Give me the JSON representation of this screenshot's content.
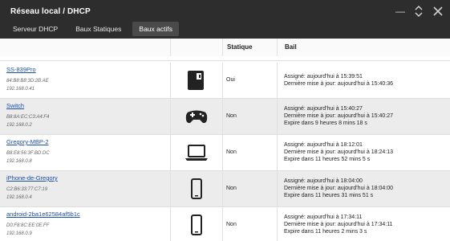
{
  "window": {
    "title": "Réseau local / DHCP"
  },
  "tabs": [
    {
      "label": "Serveur DHCP",
      "active": false
    },
    {
      "label": "Baux Statiques",
      "active": false
    },
    {
      "label": "Baux actifs",
      "active": true
    }
  ],
  "table": {
    "columns": [
      "",
      "",
      "Statique",
      "Bail"
    ],
    "rows": [
      {
        "name": "SS-839Pro",
        "mac": "84:B8:B8:3D:2B:AE",
        "ip": "192.168.0.41",
        "icon": "nas-icon",
        "static": "Oui",
        "lease": [
          "Assigné: aujourd'hui à 15:39:51",
          "Dernière mise à jour: aujourd'hui à 15:40:36"
        ]
      },
      {
        "name": "Switch",
        "mac": "B8:8A:EC:C3:A4:F4",
        "ip": "192.168.0.2",
        "icon": "gamepad-icon",
        "static": "Non",
        "lease": [
          "Assigné: aujourd'hui à 15:40:27",
          "Dernière mise à jour: aujourd'hui à 15:40:27",
          "Expire dans 9 heures 8 mins 18 s"
        ]
      },
      {
        "name": "Gregory-MBP-2",
        "mac": "B8:E8:56:3F:BD:DC",
        "ip": "192.168.0.8",
        "icon": "laptop-icon",
        "static": "Non",
        "lease": [
          "Assigné: aujourd'hui à 18:12:01",
          "Dernière mise à jour: aujourd'hui à 18:24:13",
          "Expire dans 11 heures 52 mins 5 s"
        ]
      },
      {
        "name": "iPhone-de-Gregory",
        "mac": "C2:B6:33:77:C7:19",
        "ip": "192.168.0.4",
        "icon": "phone-icon",
        "static": "Non",
        "lease": [
          "Assigné: aujourd'hui à 18:04:00",
          "Dernière mise à jour: aujourd'hui à 18:04:00",
          "Expire dans 11 heures 31 mins 51 s"
        ]
      },
      {
        "name": "android-2ba1e62584af5b1c",
        "mac": "D0:F8:8C:EE:0E:FF",
        "ip": "192.168.0.9",
        "icon": "phone-icon",
        "static": "Non",
        "lease": [
          "Assigné: aujourd'hui à 17:34:11",
          "Dernière mise à jour: aujourd'hui à 17:34:11",
          "Expire dans 11 heures 2 mins 3 s"
        ]
      }
    ]
  }
}
